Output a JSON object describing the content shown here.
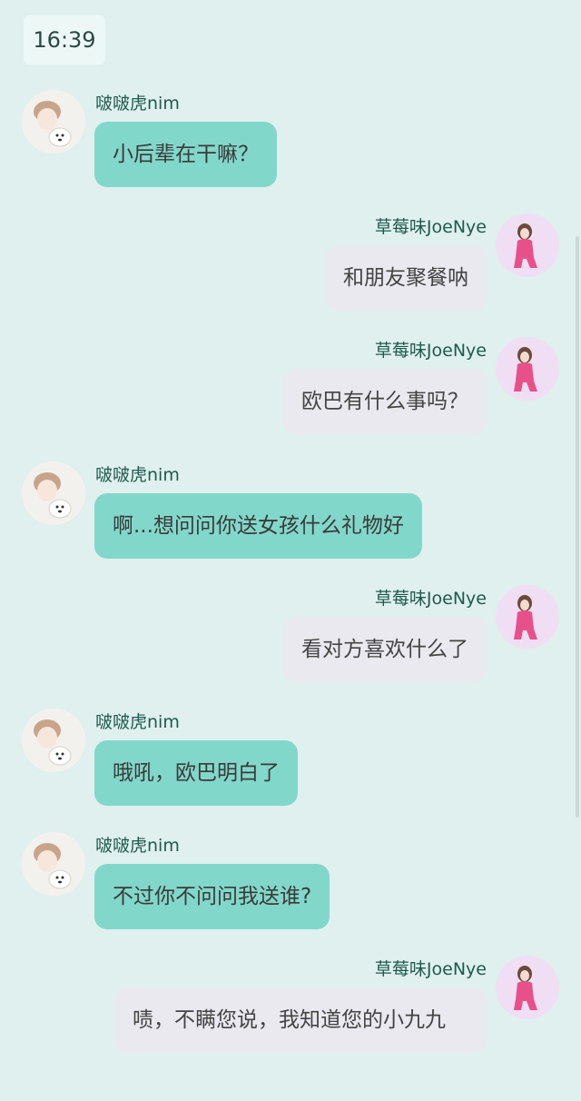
{
  "status": {
    "time": "16:39"
  },
  "contacts": {
    "left_name": "啵啵虎nim",
    "right_name": "草莓味JoeNye"
  },
  "colors": {
    "background": "#dff0ee",
    "left_bubble": "#82d7cb",
    "right_bubble": "#e9e9ef",
    "name_text": "#1e5a4e"
  },
  "messages": [
    {
      "sender": "啵啵虎nim",
      "text": "小后辈在干嘛？"
    },
    {
      "sender": "草莓味JoeNye",
      "text": "和朋友聚餐呐"
    },
    {
      "sender": "草莓味JoeNye",
      "text": "欧巴有什么事吗？"
    },
    {
      "sender": "啵啵虎nim",
      "text": "啊...想问问你送女孩什么礼物好"
    },
    {
      "sender": "草莓味JoeNye",
      "text": "看对方喜欢什么了"
    },
    {
      "sender": "啵啵虎nim",
      "text": "哦吼，欧巴明白了"
    },
    {
      "sender": "啵啵虎nim",
      "text": "不过你不问问我送谁?"
    },
    {
      "sender": "草莓味JoeNye",
      "text": "啧，不瞒您说，我知道您的小九九"
    }
  ]
}
